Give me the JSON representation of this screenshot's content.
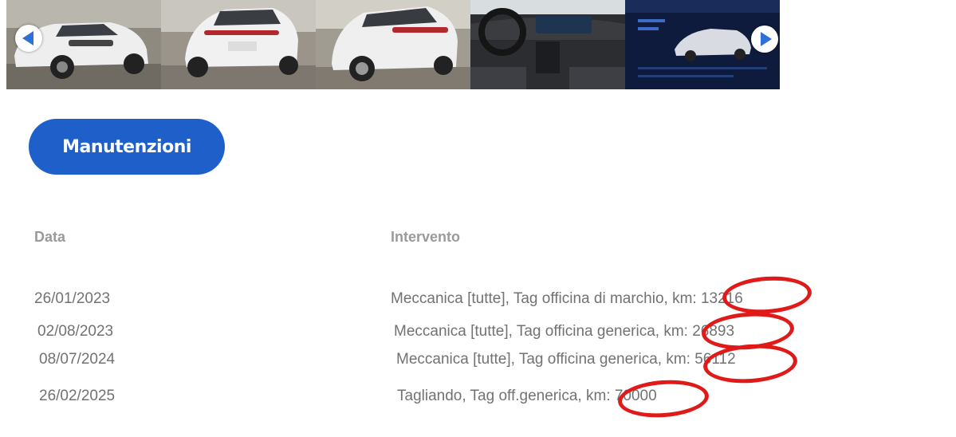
{
  "gallery": {
    "prev_arrow_icon": "chevron-left-icon",
    "next_arrow_icon": "chevron-right-icon",
    "photos": [
      "car-front-photo",
      "car-rear-photo",
      "car-rear-side-photo",
      "car-interior-photo",
      "car-display-photo"
    ]
  },
  "tab": {
    "label": "Manutenzioni"
  },
  "table": {
    "headers": {
      "date": "Data",
      "service": "Intervento"
    },
    "rows": [
      {
        "date": "26/01/2023",
        "service": "Meccanica [tutte], Tag officina di marchio, km: 13216"
      },
      {
        "date": "02/08/2023",
        "service": "Meccanica [tutte], Tag officina generica, km: 26893"
      },
      {
        "date": "08/07/2024",
        "service": "Meccanica [tutte], Tag officina generica, km: 56112"
      },
      {
        "date": "26/02/2025",
        "service": "Tagliando, Tag off.generica, km: 70000"
      }
    ]
  },
  "colors": {
    "accent": "#1f5fc9",
    "highlight": "#e01919",
    "text": "#727272",
    "header": "#9a9a9a"
  }
}
